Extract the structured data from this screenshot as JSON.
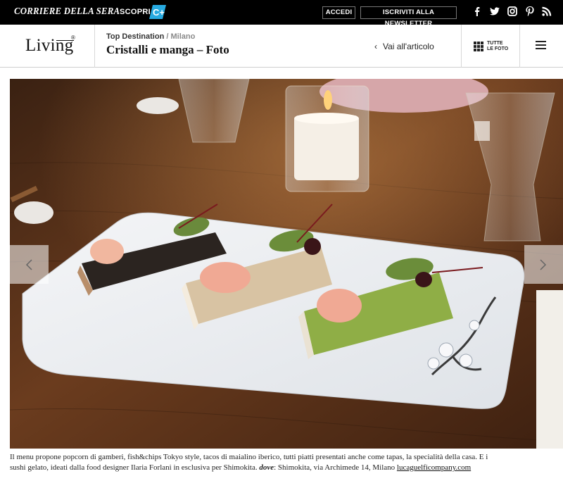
{
  "topbar": {
    "brand": "CORRIERE DELLA SERA",
    "discover_label": "SCOPRI",
    "discover_badge": "C+",
    "login_label": "ACCEDI",
    "newsletter_label": "ISCRIVITI ALLA NEWSLETTER",
    "social": [
      "facebook-icon",
      "twitter-icon",
      "instagram-icon",
      "pinterest-icon",
      "rss-icon"
    ]
  },
  "header": {
    "logo": "Living",
    "logo_mark": "®",
    "section": "Top Destination",
    "separator": " / ",
    "city": "Milano",
    "title": "Cristalli e manga – Foto",
    "back_label": "Vai all'articolo",
    "back_icon": "‹",
    "all_photos_line1": "TUTTE",
    "all_photos_line2": "LE FOTO"
  },
  "gallery": {
    "image_alt": "Sushi rolls coated in sesame seeds and pistachio on a white plate",
    "prev_icon": "chevron-left-icon",
    "next_icon": "chevron-right-icon"
  },
  "caption": {
    "text": "Il menu propone popcorn di gamberi, fish&chips Tokyo style, tacos di maialino iberico, tutti piatti presentati anche come tapas, la specialità della casa. E i sushi gelato, ideati dalla food designer Ilaria Forlani in esclusiva per Shimokita.",
    "dove_label": "dove",
    "address": ": Shimokita, via Archimede 14, Milano",
    "credit_link": "lucaguelficompany.com"
  },
  "colors": {
    "topbar_bg": "#000000",
    "accent_c_plus": "#27aae1",
    "crumb_grey": "#8a8a8a"
  }
}
